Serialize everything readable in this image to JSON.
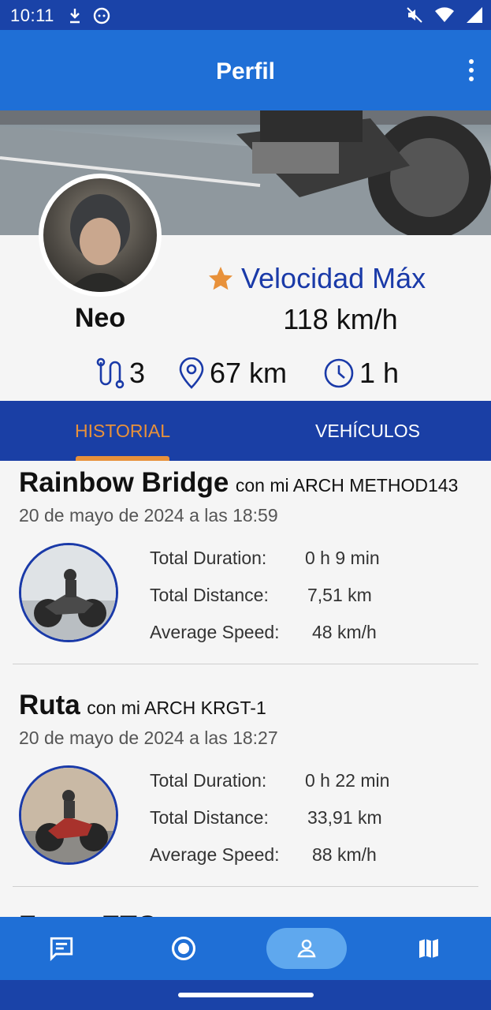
{
  "status_bar": {
    "time": "10:11"
  },
  "app_bar": {
    "title": "Perfil"
  },
  "profile": {
    "name": "Neo",
    "max_speed_label": "Velocidad Máx",
    "max_speed_value": "118 km/h",
    "stats": {
      "routes": "3",
      "distance": "67 km",
      "time": "1 h"
    }
  },
  "tabs": [
    {
      "label": "HISTORIAL",
      "selected": true
    },
    {
      "label": "VEHÍCULOS",
      "selected": false
    }
  ],
  "trips": [
    {
      "name": "Rainbow Bridge",
      "vehicle": "con mi ARCH METHOD143",
      "date": "20 de mayo de 2024 a las 18:59",
      "stats": [
        {
          "label": "Total Duration:",
          "value": "0 h 9 min"
        },
        {
          "label": "Total Distance:",
          "value": "7,51 km"
        },
        {
          "label": "Average Speed:",
          "value": "48 km/h"
        }
      ]
    },
    {
      "name": "Ruta",
      "vehicle": "con mi ARCH KRGT-1",
      "date": "20 de mayo de 2024 a las 18:27",
      "stats": [
        {
          "label": "Total Duration:",
          "value": "0 h 22 min"
        },
        {
          "label": "Total Distance:",
          "value": "33,91 km"
        },
        {
          "label": "Average Speed:",
          "value": "88 km/h"
        }
      ]
    }
  ],
  "peek_title": "Fuera ETC",
  "bottom_nav": [
    {
      "icon": "chat-icon",
      "selected": false
    },
    {
      "icon": "record-icon",
      "selected": false
    },
    {
      "icon": "profile-icon",
      "selected": true
    },
    {
      "icon": "map-icon",
      "selected": false
    }
  ],
  "colors": {
    "primary": "#1f6fd6",
    "dark": "#1a3fa5",
    "accent": "#e8913a",
    "star": "#e8913a"
  }
}
